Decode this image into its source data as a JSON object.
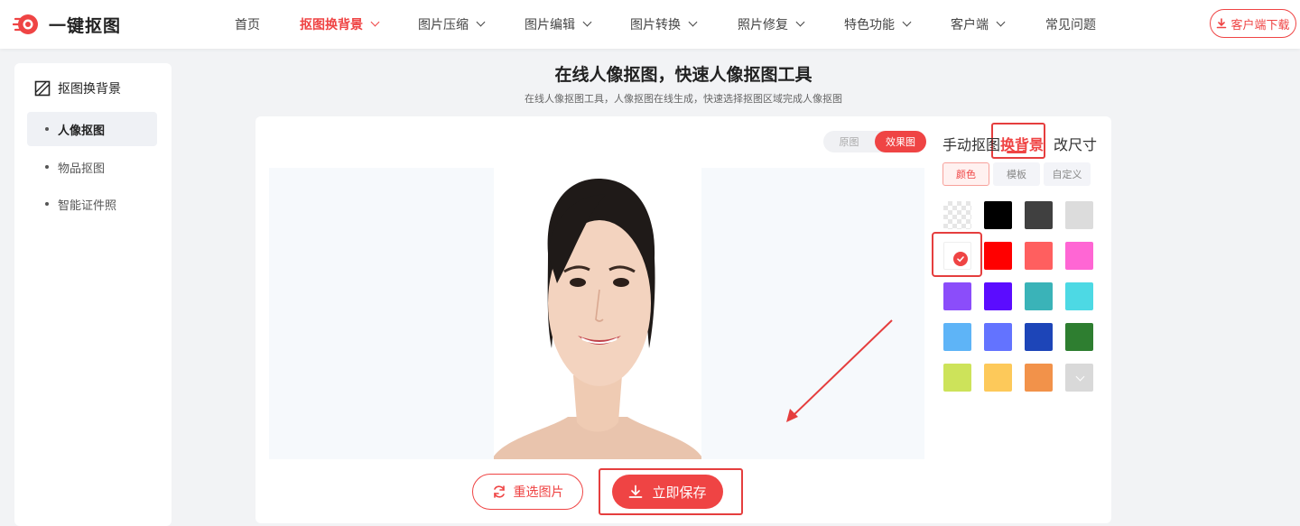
{
  "logo": {
    "text": "一键抠图",
    "icon": "logo-ring-icon"
  },
  "nav": {
    "items": [
      {
        "label": "首页",
        "has_dropdown": false,
        "active": false
      },
      {
        "label": "抠图换背景",
        "has_dropdown": true,
        "active": true
      },
      {
        "label": "图片压缩",
        "has_dropdown": true,
        "active": false
      },
      {
        "label": "图片编辑",
        "has_dropdown": true,
        "active": false
      },
      {
        "label": "图片转换",
        "has_dropdown": true,
        "active": false
      },
      {
        "label": "照片修复",
        "has_dropdown": true,
        "active": false
      },
      {
        "label": "特色功能",
        "has_dropdown": true,
        "active": false
      },
      {
        "label": "客户端",
        "has_dropdown": true,
        "active": false
      },
      {
        "label": "常见问题",
        "has_dropdown": false,
        "active": false
      }
    ],
    "download_label": "客户端下载"
  },
  "sidebar": {
    "title": "抠图换背景",
    "items": [
      {
        "label": "人像抠图",
        "active": true
      },
      {
        "label": "物品抠图",
        "active": false
      },
      {
        "label": "智能证件照",
        "active": false
      }
    ]
  },
  "main": {
    "title": "在线人像抠图，快速人像抠图工具",
    "subtitle": "在线人像抠图工具，人像抠图在线生成，快速选择抠图区域完成人像抠图",
    "view_toggle": {
      "original": "原图",
      "result": "效果图",
      "selected": "效果图"
    },
    "reselect_label": "重选图片",
    "save_label": "立即保存"
  },
  "panel": {
    "tabs": [
      {
        "label": "手动抠图",
        "active": false
      },
      {
        "label": "换背景",
        "active": true
      },
      {
        "label": "改尺寸",
        "active": false
      }
    ],
    "subtabs": [
      {
        "label": "颜色",
        "active": true
      },
      {
        "label": "模板",
        "active": false
      },
      {
        "label": "自定义",
        "active": false
      }
    ],
    "colors": [
      "transparent",
      "#000000",
      "#404040",
      "#dcdcdc",
      "#ffffff",
      "#ff0000",
      "#ff5f5f",
      "#ff66d4",
      "#8b4dfa",
      "#5b0cff",
      "#3ab3b8",
      "#4dd9e4",
      "#5eb4f7",
      "#6373ff",
      "#1d45b8",
      "#2e7e30",
      "#cde35a",
      "#fdc95a",
      "#f2924a",
      "more"
    ],
    "selected_color": "#ffffff"
  },
  "accent": "#ef4444"
}
